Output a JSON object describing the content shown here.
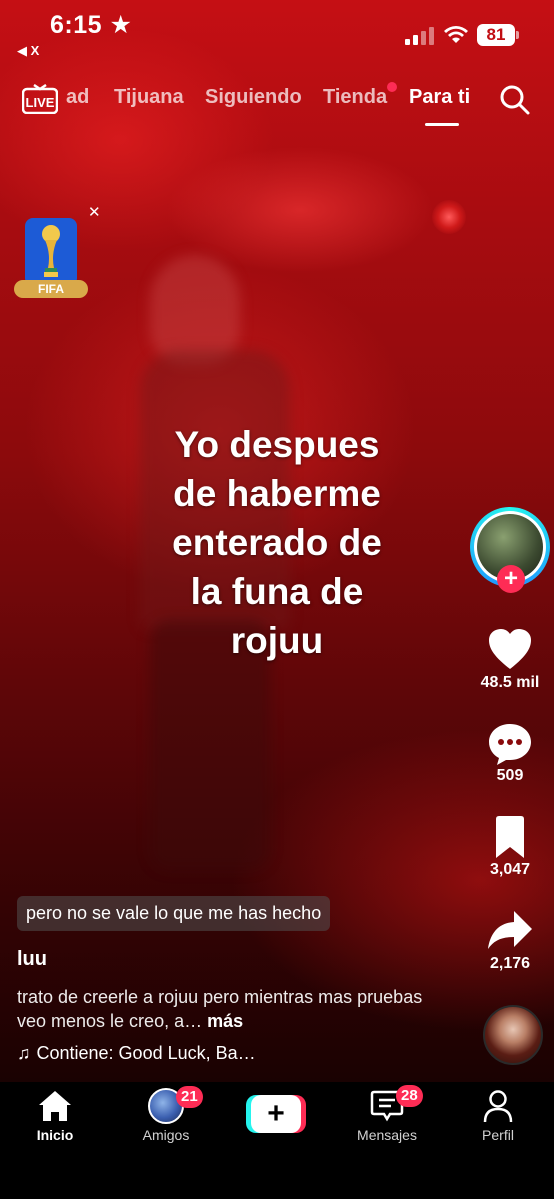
{
  "status_bar": {
    "time": "6:15",
    "battery": "81",
    "back_app": "◀ X"
  },
  "top_nav": {
    "live_label": "LIVE",
    "tabs": [
      {
        "label": "ad",
        "active": false
      },
      {
        "label": "Tijuana",
        "active": false
      },
      {
        "label": "Siguiendo",
        "active": false
      },
      {
        "label": "Tienda",
        "active": false
      },
      {
        "label": "Para ti",
        "active": true
      }
    ]
  },
  "sticker": {
    "label": "FIFA"
  },
  "video": {
    "overlay_text": "Yo despues\nde haberme\nenterado de\nla funa de\nrojuu"
  },
  "rail": {
    "likes": "48.5 mil",
    "comments": "509",
    "saves": "3,047",
    "shares": "2,176"
  },
  "post": {
    "lyric": "pero no se vale lo que me has hecho",
    "username": "luu",
    "description": "trato de creerle a rojuu pero mientras mas pruebas veo menos le creo, a…",
    "more_label": "más",
    "music_label": "Contiene: Good Luck, Ba…"
  },
  "bottom_nav": {
    "items": [
      {
        "label": "Inicio",
        "active": true
      },
      {
        "label": "Amigos",
        "badge": "21"
      },
      {
        "label": "Mensajes",
        "badge": "28"
      },
      {
        "label": "Perfil"
      }
    ],
    "create_label": "+"
  },
  "colors": {
    "accent_red": "#fe2c55",
    "accent_cyan": "#25f4ee",
    "video_red": "#b80d12"
  }
}
